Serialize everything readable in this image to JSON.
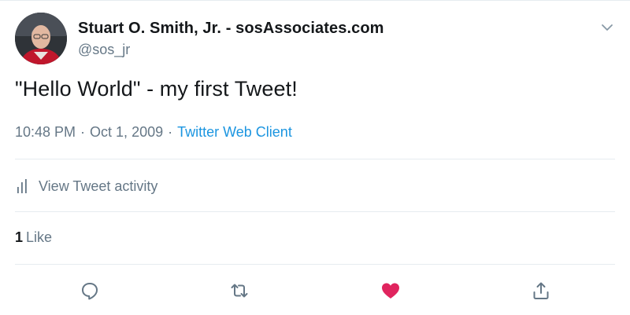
{
  "author": {
    "display_name": "Stuart O. Smith, Jr. - sosAssociates.com",
    "handle": "@sos_jr"
  },
  "tweet": {
    "text": "\"Hello World\" - my first Tweet!",
    "time": "10:48 PM",
    "date": "Oct 1, 2009",
    "separator": "·",
    "source": "Twitter Web Client"
  },
  "activity": {
    "label": "View Tweet activity",
    "icon": "bar-chart-icon"
  },
  "likes": {
    "count": "1",
    "label": "Like"
  },
  "actions": {
    "reply_icon": "reply-icon",
    "retweet_icon": "retweet-icon",
    "like_icon": "heart-icon",
    "share_icon": "share-icon",
    "liked_color": "#e0245e",
    "icon_color": "#657786"
  },
  "colors": {
    "text": "#14171a",
    "secondary": "#657786",
    "link": "#1b95e0",
    "divider": "#e6ecf0"
  }
}
